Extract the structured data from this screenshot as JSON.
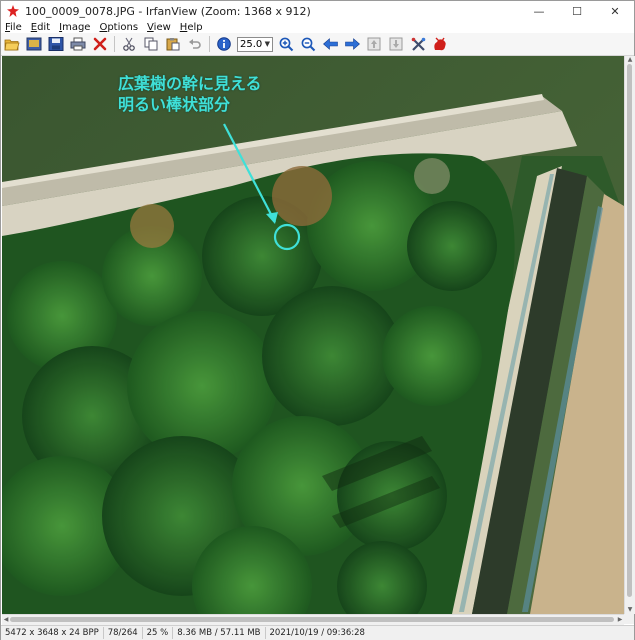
{
  "window": {
    "title": "100_0009_0078.JPG - IrfanView (Zoom: 1368 x 912)",
    "controls": {
      "minimize": "—",
      "maximize": "☐",
      "close": "✕"
    }
  },
  "menu": [
    {
      "key": "F",
      "rest": "ile"
    },
    {
      "key": "E",
      "rest": "dit"
    },
    {
      "key": "I",
      "rest": "mage"
    },
    {
      "key": "O",
      "rest": "ptions"
    },
    {
      "key": "V",
      "rest": "iew"
    },
    {
      "key": "H",
      "rest": "elp"
    }
  ],
  "toolbar": {
    "zoom_value": "25.0",
    "icons": [
      "open-icon",
      "slideshow-icon",
      "save-icon",
      "print-icon",
      "delete-icon",
      "cut-icon",
      "copy-icon",
      "paste-icon",
      "undo-icon",
      "info-icon",
      "zoom-in-icon",
      "zoom-out-icon",
      "previous-icon",
      "next-icon",
      "first-page-icon",
      "last-page-icon",
      "settings-icon",
      "irfanview-icon"
    ]
  },
  "annotation": {
    "line1": "広葉樹の幹に見える",
    "line2": "明るい棒状部分",
    "color": "#3fe0d8"
  },
  "status": {
    "dimensions": "5472 x 3648 x 24 BPP",
    "index": "78/264",
    "zoom": "25 %",
    "memory": "8.36 MB / 57.11 MB",
    "datetime": "2021/10/19 / 09:36:28"
  },
  "colors": {
    "water": "#3f5a2e",
    "foliage": "#2f6d2c",
    "road": "#c9c5b5",
    "marker": "#3fe0d8"
  }
}
